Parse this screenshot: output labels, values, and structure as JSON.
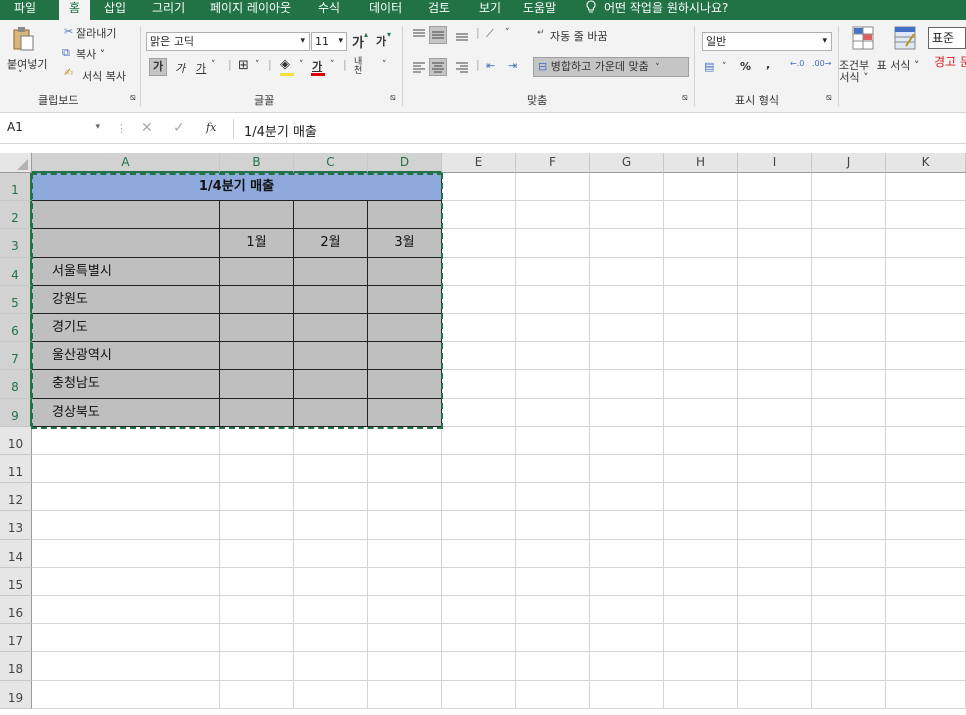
{
  "menu": [
    "파일",
    "홈",
    "삽입",
    "그리기",
    "페이지 레이아웃",
    "수식",
    "데이터",
    "검토",
    "보기",
    "도움말"
  ],
  "tell_me": "어떤 작업을 원하시나요?",
  "ribbon": {
    "clipboard": {
      "paste": "붙여넣기",
      "cut": "잘라내기",
      "copy": "복사 ˅",
      "format_painter": "서식 복사",
      "label": "클립보드"
    },
    "font": {
      "name": "맑은 고딕",
      "size": "11",
      "grow": "가",
      "shrink": "가",
      "bold": "가",
      "italic": "가",
      "underline": "가",
      "font_color_glyph": "가",
      "phonetic_glyph": "내천",
      "label": "글꼴"
    },
    "alignment": {
      "wrap_text": "자동 줄 바꿈",
      "merge_center": "병합하고 가운데 맞춤",
      "label": "맞춤"
    },
    "number": {
      "format": "일반",
      "percent": "%",
      "comma": ",",
      "label": "표시 형식"
    },
    "styles": {
      "conditional": "조건부 서식 ˅",
      "table_format": "표 서식 ˅",
      "normal": "표준",
      "warning": "경고 문"
    }
  },
  "formula_bar": {
    "name_box": "A1",
    "fx": "fx",
    "content": "1/4분기 매출"
  },
  "columns": [
    "A",
    "B",
    "C",
    "D",
    "E",
    "F",
    "G",
    "H",
    "I",
    "J",
    "K"
  ],
  "rows": [
    "1",
    "2",
    "3",
    "4",
    "5",
    "6",
    "7",
    "8",
    "9",
    "10",
    "11",
    "12",
    "13",
    "14",
    "15",
    "16",
    "17",
    "18",
    "19"
  ],
  "table": {
    "title": "1/4분기 매출",
    "months": [
      "1월",
      "2월",
      "3월"
    ],
    "regions": [
      "서울특별시",
      "강원도",
      "경기도",
      "울산광역시",
      "충청남도",
      "경상북도"
    ]
  },
  "colors": {
    "accent": "#217346",
    "title_fill": "#8ea9db",
    "table_fill": "#bfbfbf"
  }
}
